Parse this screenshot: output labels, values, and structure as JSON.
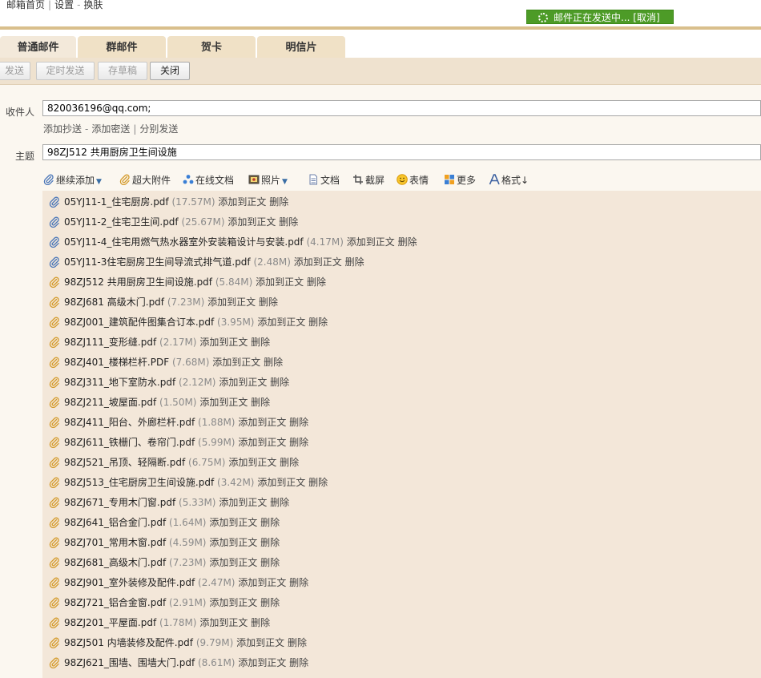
{
  "top_nav": {
    "home": "邮箱首页",
    "settings": "设置",
    "skin": "换肤",
    "sep1": "|",
    "sep2": "-"
  },
  "sending_notice": {
    "text": "邮件正在发送中...",
    "cancel": "[取消]",
    "bg_color": "#4d9b27"
  },
  "tabs": [
    "普通邮件",
    "群邮件",
    "贺卡",
    "明信片"
  ],
  "toolbar": {
    "send": "发送",
    "schedule": "定时发送",
    "save_draft": "存草稿",
    "close": "关闭"
  },
  "form": {
    "to_label": "收件人",
    "to_value": "820036196@qq.com;",
    "add_cc": "添加抄送",
    "add_bcc": "添加密送",
    "separate_send": "分别发送",
    "dash": "-",
    "bar": "|",
    "subject_label": "主题",
    "subject_value": "98ZJ512 共用厨房卫生间设施"
  },
  "attach_toolbar": {
    "continue_add": "继续添加",
    "large_attachment": "超大附件",
    "online_doc": "在线文档",
    "photo": "照片",
    "document": "文档",
    "screenshot": "截屏",
    "emoji": "表情",
    "more": "更多",
    "format": "格式↓"
  },
  "attachment_actions": {
    "add_to_body": "添加到正文",
    "delete": "删除"
  },
  "attachments": [
    {
      "name": "05YJ11-1_住宅厨房.pdf",
      "size": "(17.57M)",
      "icon": "paperclip-blue"
    },
    {
      "name": "05YJ11-2_住宅卫生间.pdf",
      "size": "(25.67M)",
      "icon": "paperclip-blue"
    },
    {
      "name": "05YJ11-4_住宅用燃气热水器室外安装箱设计与安装.pdf",
      "size": "(4.17M)",
      "icon": "paperclip-blue"
    },
    {
      "name": "05YJ11-3住宅厨房卫生间导流式排气道.pdf",
      "size": "(2.48M)",
      "icon": "paperclip-blue"
    },
    {
      "name": "98ZJ512 共用厨房卫生间设施.pdf",
      "size": "(5.84M)",
      "icon": "paperclip-orange"
    },
    {
      "name": "98ZJ681 高级木门.pdf",
      "size": "(7.23M)",
      "icon": "paperclip-orange"
    },
    {
      "name": "98ZJ001_建筑配件图集合订本.pdf",
      "size": "(3.95M)",
      "icon": "paperclip-orange"
    },
    {
      "name": "98ZJ111_变形缝.pdf",
      "size": "(2.17M)",
      "icon": "paperclip-orange"
    },
    {
      "name": "98ZJ401_楼梯栏杆.PDF",
      "size": "(7.68M)",
      "icon": "paperclip-orange"
    },
    {
      "name": "98ZJ311_地下室防水.pdf",
      "size": "(2.12M)",
      "icon": "paperclip-orange"
    },
    {
      "name": "98ZJ211_坡屋面.pdf",
      "size": "(1.50M)",
      "icon": "paperclip-orange"
    },
    {
      "name": "98ZJ411_阳台、外廊栏杆.pdf",
      "size": "(1.88M)",
      "icon": "paperclip-orange"
    },
    {
      "name": "98ZJ611_铁栅门、卷帘门.pdf",
      "size": "(5.99M)",
      "icon": "paperclip-orange"
    },
    {
      "name": "98ZJ521_吊顶、轻隔断.pdf",
      "size": "(6.75M)",
      "icon": "paperclip-orange"
    },
    {
      "name": "98ZJ513_住宅厨房卫生间设施.pdf",
      "size": "(3.42M)",
      "icon": "paperclip-orange"
    },
    {
      "name": "98ZJ671_专用木门窗.pdf",
      "size": "(5.33M)",
      "icon": "paperclip-orange"
    },
    {
      "name": "98ZJ641_铝合金门.pdf",
      "size": "(1.64M)",
      "icon": "paperclip-orange"
    },
    {
      "name": "98ZJ701_常用木窗.pdf",
      "size": "(4.59M)",
      "icon": "paperclip-orange"
    },
    {
      "name": "98ZJ681_高级木门.pdf",
      "size": "(7.23M)",
      "icon": "paperclip-orange"
    },
    {
      "name": "98ZJ901_室外装修及配件.pdf",
      "size": "(2.47M)",
      "icon": "paperclip-orange"
    },
    {
      "name": "98ZJ721_铝合金窗.pdf",
      "size": "(2.91M)",
      "icon": "paperclip-orange"
    },
    {
      "name": "98ZJ201_平屋面.pdf",
      "size": "(1.78M)",
      "icon": "paperclip-orange"
    },
    {
      "name": "98ZJ501 内墙装修及配件.pdf",
      "size": "(9.79M)",
      "icon": "paperclip-orange"
    },
    {
      "name": "98ZJ621_围墙、围墙大门.pdf",
      "size": "(8.61M)",
      "icon": "paperclip-orange"
    }
  ],
  "colors": {
    "tab_bg": "#f0e1c6",
    "toolbar_bg": "#efe2cf",
    "attachment_list_bg": "#f3e7d9",
    "accent_line": "#d9bf8c"
  }
}
